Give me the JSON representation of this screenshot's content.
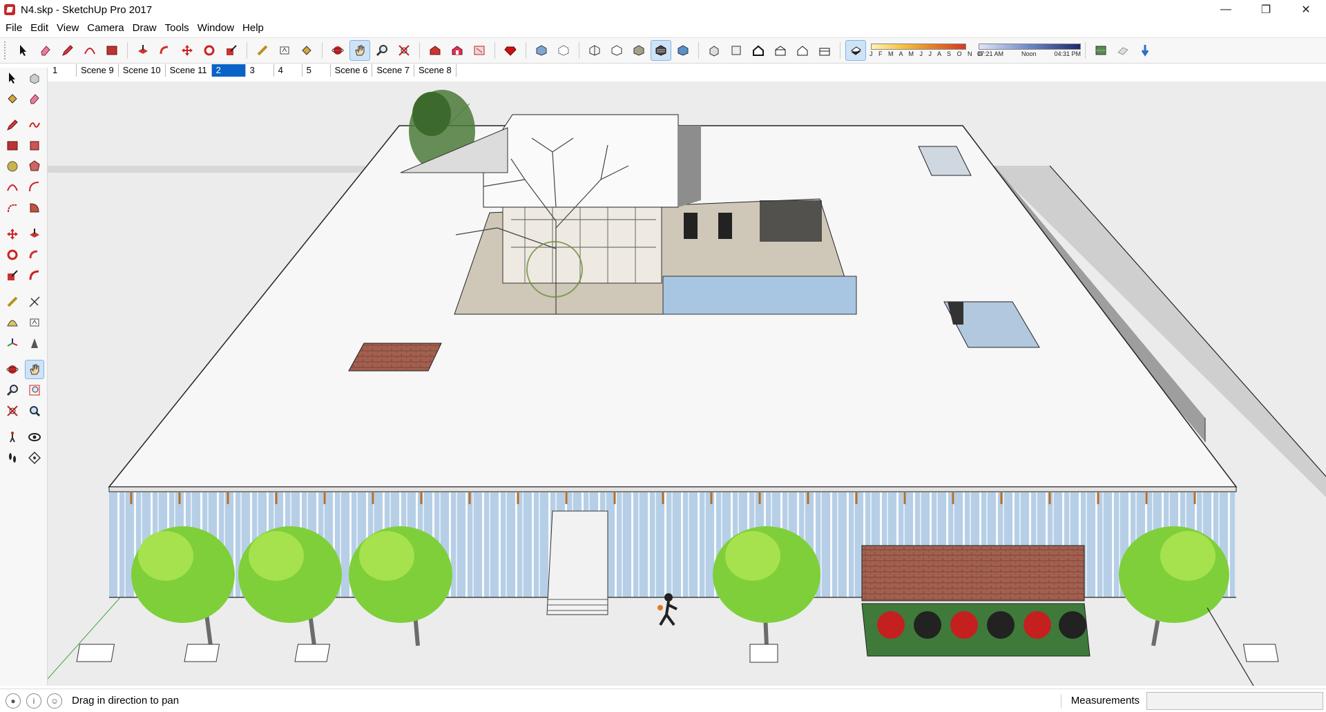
{
  "window": {
    "title": "N4.skp - SketchUp Pro 2017",
    "controls": {
      "minimize": "—",
      "restore": "❐",
      "close": "✕"
    }
  },
  "menu": {
    "items": [
      {
        "label": "File"
      },
      {
        "label": "Edit"
      },
      {
        "label": "View"
      },
      {
        "label": "Camera"
      },
      {
        "label": "Draw"
      },
      {
        "label": "Tools"
      },
      {
        "label": "Window"
      },
      {
        "label": "Help"
      }
    ]
  },
  "shadow_settings": {
    "months": "J F M A M J J A S O N D",
    "time_start": "07:21 AM",
    "time_mid": "Noon",
    "time_end": "04:31 PM"
  },
  "scenes": {
    "tabs": [
      {
        "label": "1",
        "active": false
      },
      {
        "label": "Scene 9",
        "active": false
      },
      {
        "label": "Scene 10",
        "active": false
      },
      {
        "label": "Scene 11",
        "active": false
      },
      {
        "label": "2",
        "active": true
      },
      {
        "label": "3",
        "active": false
      },
      {
        "label": "4",
        "active": false
      },
      {
        "label": "5",
        "active": false
      },
      {
        "label": "Scene 6",
        "active": false
      },
      {
        "label": "Scene 7",
        "active": false
      },
      {
        "label": "Scene 8",
        "active": false
      }
    ]
  },
  "status": {
    "hint": "Drag in direction to pan",
    "measurements_label": "Measurements",
    "measurements_value": ""
  },
  "colors": {
    "accent": "#0a64c8",
    "active_tool_bg": "#cfe3f7",
    "roof": "#f7f7f7",
    "glass": "#a9c6e0",
    "brick": "#9b5a4a",
    "tree": "#5cad2a",
    "ground": "#eaeaea"
  },
  "icons": {
    "top_toolbar": [
      "select-icon",
      "eraser-icon",
      "pencil-icon",
      "arc-icon",
      "rectangle-icon",
      "push-pull-icon",
      "follow-me-icon",
      "move-icon",
      "rotate-icon",
      "scale-icon",
      "tape-measure-icon",
      "text-icon",
      "paint-bucket-icon",
      "orbit-icon",
      "pan-icon",
      "zoom-icon",
      "zoom-extents-icon",
      "warehouse-icon",
      "extension-warehouse-icon",
      "layout-icon",
      "ruby-icon",
      "xray-icon",
      "back-edges-icon",
      "wireframe-icon",
      "hidden-line-icon",
      "shaded-icon",
      "shaded-textures-icon",
      "monochrome-icon",
      "iso-view-icon",
      "top-view-icon",
      "front-view-icon",
      "right-view-icon",
      "back-view-icon",
      "left-view-icon",
      "shadows-toggle-icon",
      "geo-location-icon",
      "fog-icon",
      "sandbox-icon"
    ]
  }
}
